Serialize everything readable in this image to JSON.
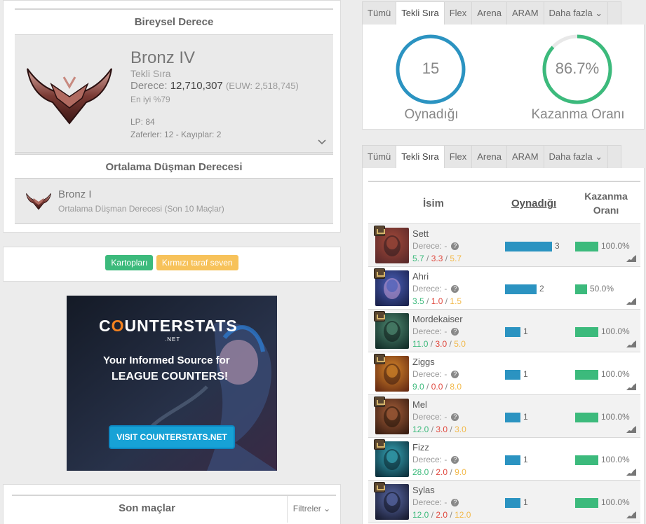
{
  "rank": {
    "section_title": "Bireysel Derece",
    "tier": "Bronz IV",
    "queue": "Tekli Sıra",
    "rank_label": "Derece:",
    "rank_value": "12,710,307",
    "rank_euw": "(EUW: 2,518,745)",
    "top_percent": "En iyi %79",
    "lp": "LP: 84",
    "wins_losses": "Zaferler: 12 - Kayıplar: 2",
    "expand_icon": "chevron-down-icon"
  },
  "enemy": {
    "section_title": "Ortalama Düşman Derecesi",
    "tier": "Bronz I",
    "subtitle": "Ortalama Düşman Derecesi (Son 10 Maçlar)"
  },
  "tags": [
    {
      "label": "Kartopları",
      "color": "#3cba7c"
    },
    {
      "label": "Kırmızı taraf seven",
      "color": "#f7c25a"
    }
  ],
  "ad": {
    "logo_pre": "C",
    "logo_o": "O",
    "logo_post": "UNTERSTATS",
    "logo_sub": ".NET",
    "line1": "Your Informed Source for",
    "line2": "LEAGUE COUNTERS!",
    "cta": "VISIT COUNTERSTATS.NET"
  },
  "recent": {
    "title": "Son maçlar",
    "filters": "Filtreler ⌄"
  },
  "tabs_top": [
    "Tümü",
    "Tekli Sıra",
    "Flex",
    "Arena",
    "ARAM",
    "Daha fazla ⌄"
  ],
  "tabs_mid": [
    "Tümü",
    "Tekli Sıra",
    "Flex",
    "Arena",
    "ARAM",
    "Daha fazla ⌄"
  ],
  "active_tab_index": 1,
  "stats": {
    "played_value": "15",
    "played_label": "Oynadığı",
    "winrate_value": "86.7%",
    "winrate_label": "Kazanma Oranı",
    "winrate_fraction": 0.867,
    "ring_blue": "#2b93c1",
    "ring_green": "#3cba7c"
  },
  "champ_table": {
    "headers": {
      "name": "İsim",
      "played": "Oynadığı",
      "winrate": "Kazanma Oranı"
    },
    "rank_label": "Derece: -",
    "rows": [
      {
        "name": "Sett",
        "k": "5.7",
        "d": "3.3",
        "a": "5.7",
        "played": 3,
        "winrate": "100.0%",
        "win_fraction": 1.0,
        "colors": [
          "#5c2a2a",
          "#a44a3a",
          "#2a1a1e"
        ]
      },
      {
        "name": "Ahri",
        "k": "3.5",
        "d": "1.0",
        "a": "1.5",
        "played": 2,
        "winrate": "50.0%",
        "win_fraction": 0.5,
        "colors": [
          "#1c2450",
          "#4a5fb8",
          "#c9a0d8"
        ]
      },
      {
        "name": "Mordekaiser",
        "k": "11.0",
        "d": "3.0",
        "a": "5.0",
        "played": 1,
        "winrate": "100.0%",
        "win_fraction": 1.0,
        "colors": [
          "#14302a",
          "#4f8a72",
          "#0c1816"
        ]
      },
      {
        "name": "Ziggs",
        "k": "9.0",
        "d": "0.0",
        "a": "8.0",
        "played": 1,
        "winrate": "100.0%",
        "win_fraction": 1.0,
        "colors": [
          "#6a2e14",
          "#d8882a",
          "#3a1a0e"
        ]
      },
      {
        "name": "Mel",
        "k": "12.0",
        "d": "3.0",
        "a": "3.0",
        "played": 1,
        "winrate": "100.0%",
        "win_fraction": 1.0,
        "colors": [
          "#3a1e12",
          "#a8603a",
          "#1e1008"
        ]
      },
      {
        "name": "Fizz",
        "k": "28.0",
        "d": "2.0",
        "a": "9.0",
        "played": 1,
        "winrate": "100.0%",
        "win_fraction": 1.0,
        "colors": [
          "#0e3440",
          "#36a6b8",
          "#0a2028"
        ]
      },
      {
        "name": "Sylas",
        "k": "12.0",
        "d": "2.0",
        "a": "12.0",
        "played": 1,
        "winrate": "100.0%",
        "win_fraction": 1.0,
        "colors": [
          "#1a1e34",
          "#5a6aa8",
          "#0c0e1a"
        ]
      }
    ]
  }
}
